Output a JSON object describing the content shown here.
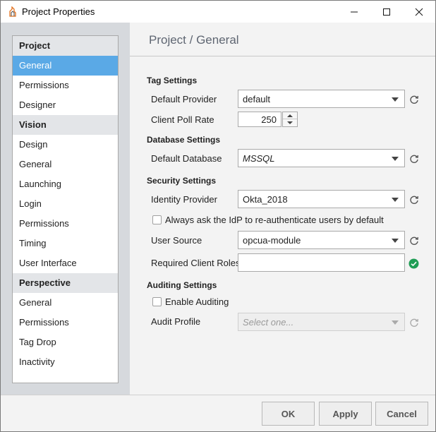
{
  "window": {
    "title": "Project Properties"
  },
  "nav": {
    "groups": [
      {
        "header": "Project",
        "items": [
          "General",
          "Permissions",
          "Designer"
        ]
      },
      {
        "header": "Vision",
        "items": [
          "Design",
          "General",
          "Launching",
          "Login",
          "Permissions",
          "Timing",
          "User Interface"
        ]
      },
      {
        "header": "Perspective",
        "items": [
          "General",
          "Permissions",
          "Tag Drop",
          "Inactivity"
        ]
      }
    ],
    "selected": "Project / General"
  },
  "page": {
    "title": "Project / General"
  },
  "tag_settings": {
    "title": "Tag Settings",
    "default_provider_label": "Default Provider",
    "default_provider_value": "default",
    "client_poll_rate_label": "Client Poll Rate",
    "client_poll_rate_value": "250"
  },
  "database_settings": {
    "title": "Database Settings",
    "default_database_label": "Default Database",
    "default_database_value": "MSSQL"
  },
  "security_settings": {
    "title": "Security Settings",
    "identity_provider_label": "Identity Provider",
    "identity_provider_value": "Okta_2018",
    "reauth_label": "Always ask the IdP to re-authenticate users by default",
    "reauth_checked": false,
    "user_source_label": "User Source",
    "user_source_value": "opcua-module",
    "required_roles_label": "Required Client Roles",
    "required_roles_value": ""
  },
  "auditing_settings": {
    "title": "Auditing Settings",
    "enable_auditing_label": "Enable Auditing",
    "enable_auditing_checked": false,
    "audit_profile_label": "Audit Profile",
    "audit_profile_placeholder": "Select one..."
  },
  "footer": {
    "ok_label": "OK",
    "apply_label": "Apply",
    "cancel_label": "Cancel"
  },
  "colors": {
    "selection": "#5aa9e6",
    "success": "#1f9d55",
    "refresh_icon": "#555555"
  },
  "icons": {
    "app": "ignition-flame-icon",
    "refresh": "refresh-icon",
    "valid": "checkmark-circle-icon",
    "spinner_up": "triangle-up-icon",
    "spinner_down": "triangle-down-icon",
    "dropdown": "triangle-down-icon"
  }
}
